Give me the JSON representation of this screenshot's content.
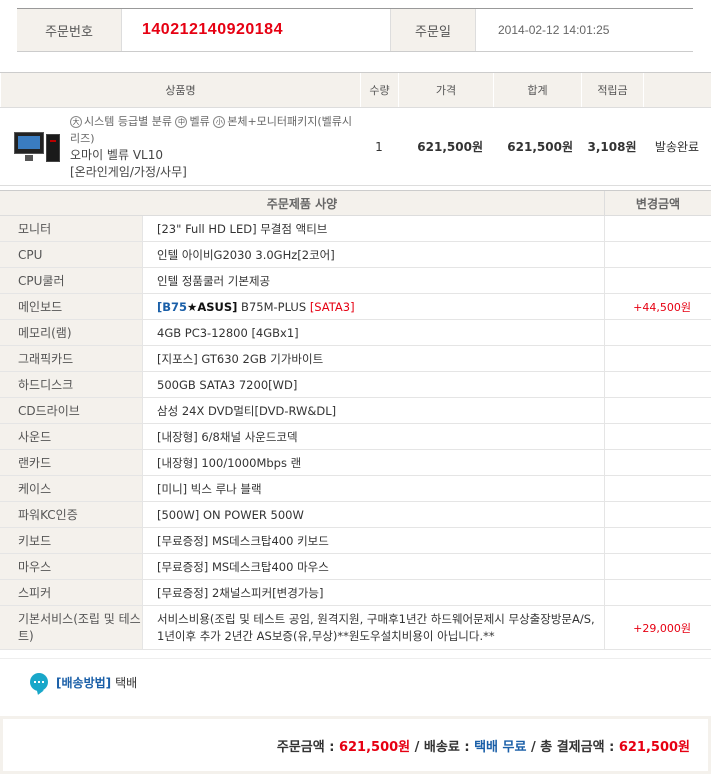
{
  "order": {
    "no_label": "주문번호",
    "no_value": "140212140920184",
    "date_label": "주문일",
    "date_value": "2014-02-12 14:01:25"
  },
  "product_table": {
    "headers": [
      "상품명",
      "수량",
      "가격",
      "합계",
      "적립금",
      ""
    ],
    "row": {
      "category_1": "시스템 등급별 분류",
      "category_2": "벨류",
      "category_3": "본체+모니터패키지(벨류시리즈)",
      "badge_1": "大",
      "badge_2": "中",
      "badge_3": "小",
      "name": "오마이 벨류 VL10",
      "sub": "[온라인게임/가정/사무]",
      "qty": "1",
      "price": "621,500원",
      "sum": "621,500원",
      "points": "3,108원",
      "status": "발송완료"
    }
  },
  "spec_table": {
    "header_main": "주문제품 사양",
    "header_add": "변경금액",
    "rows": [
      {
        "key": "모니터",
        "value": "[23\" Full HD LED] 무결점 액티브",
        "add": ""
      },
      {
        "key": "CPU",
        "value": "인텔 아이비G2030 3.0GHz[2코어]",
        "add": ""
      },
      {
        "key": "CPU쿨러",
        "value": "인텔 정품쿨러 기본제공",
        "add": ""
      },
      {
        "key": "메인보드",
        "value_b75": "[B75",
        "value_star": "★",
        "value_asus": "ASUS]",
        "value_mid": " B75M-PLUS ",
        "value_sata": "[SATA3]",
        "add": "+44,500원"
      },
      {
        "key": "메모리(램)",
        "value": "4GB PC3-12800 [4GBx1]",
        "add": ""
      },
      {
        "key": "그래픽카드",
        "value": "[지포스] GT630 2GB 기가바이트",
        "add": ""
      },
      {
        "key": "하드디스크",
        "value": "500GB SATA3 7200[WD]",
        "add": ""
      },
      {
        "key": "CD드라이브",
        "value": "삼성 24X DVD멀티[DVD-RW&DL]",
        "add": ""
      },
      {
        "key": "사운드",
        "value": "[내장형] 6/8채널 사운드코덱",
        "add": ""
      },
      {
        "key": "랜카드",
        "value": "[내장형] 100/1000Mbps 랜",
        "add": ""
      },
      {
        "key": "케이스",
        "value": "[미니] 빅스 루나 블랙",
        "add": ""
      },
      {
        "key": "파워KC인증",
        "value": "[500W] ON POWER 500W",
        "add": ""
      },
      {
        "key": "키보드",
        "value": "[무료증정] MS데스크탑400 키보드",
        "add": ""
      },
      {
        "key": "마우스",
        "value": "[무료증정] MS데스크탑400 마우스",
        "add": ""
      },
      {
        "key": "스피커",
        "value": "[무료증정] 2채널스피커[변경가능]",
        "add": ""
      },
      {
        "key": "기본서비스(조립 및 테스트)",
        "value": "서비스비용(조립 및 테스트 공임, 원격지원, 구매후1년간 하드웨어문제시 무상출장방문A/S, 1년이후 추가 2년간 AS보증(유,무상)**원도우설치비용이 아닙니다.**",
        "add": "+29,000원"
      }
    ]
  },
  "delivery": {
    "label": "[배송방법]",
    "value": "택배"
  },
  "total": {
    "order_label": "주문금액 : ",
    "order_value": "621,500원",
    "sep1": " / 배송료 : ",
    "ship_value": "택배 무료",
    "sep2": " / 총 결제금액 : ",
    "pay_value": "621,500원"
  },
  "colors": {
    "accent_red": "#e60012",
    "accent_blue": "#1a5fa8",
    "header_bg": "#f4f1ec"
  }
}
